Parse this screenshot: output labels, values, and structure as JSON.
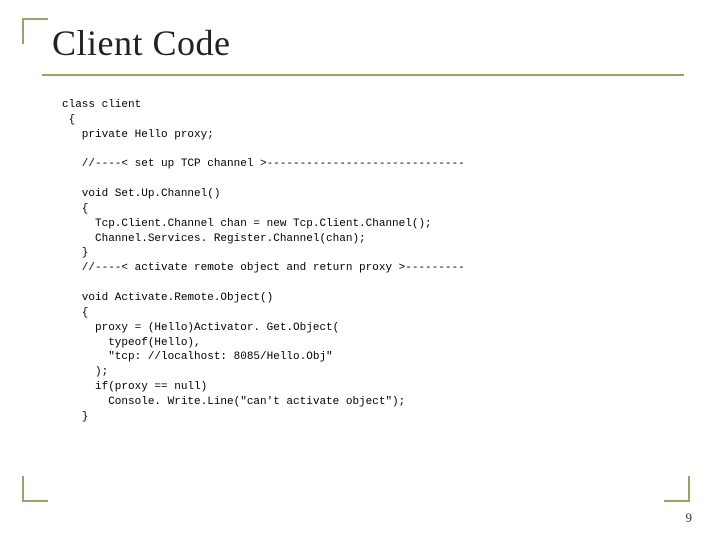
{
  "title": "Client Code",
  "page_number": "9",
  "code": "class client\n {\n   private Hello proxy;\n\n   //----< set up TCP channel >------------------------------\n\n   void Set.Up.Channel()\n   {\n     Tcp.Client.Channel chan = new Tcp.Client.Channel();\n     Channel.Services. Register.Channel(chan);\n   }\n   //----< activate remote object and return proxy >---------\n\n   void Activate.Remote.Object()\n   {\n     proxy = (Hello)Activator. Get.Object(\n       typeof(Hello),\n       \"tcp: //localhost: 8085/Hello.Obj\"\n     );\n     if(proxy == null)\n       Console. Write.Line(\"can't activate object\");\n   }"
}
